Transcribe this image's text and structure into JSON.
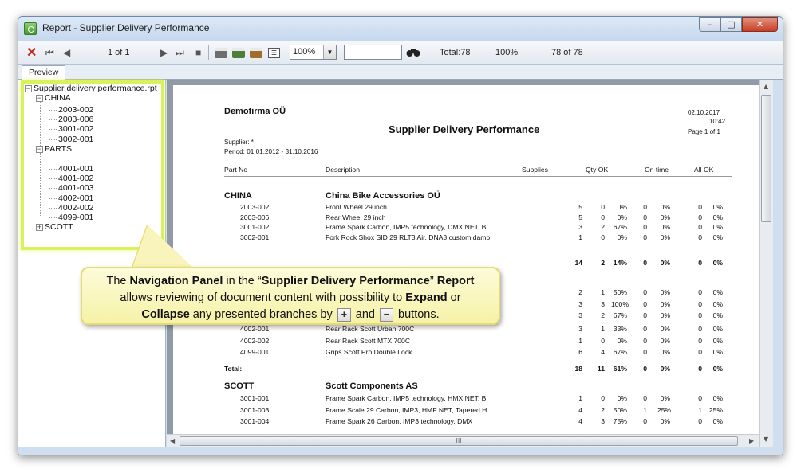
{
  "window": {
    "title": "Report - Supplier Delivery Performance",
    "buttons": {
      "minimize": "–",
      "maximize": "□",
      "close": "✕"
    }
  },
  "toolbar": {
    "close_icon": "✕",
    "first_icon": "⏮",
    "prev_icon": "◀",
    "page_indicator": "1 of 1",
    "next_icon": "▶",
    "last_icon": "⏭",
    "stop_icon": "■",
    "zoom": "100%",
    "search_value": "",
    "total": "Total:78",
    "percent": "100%",
    "record_count": "78 of 78"
  },
  "tabs": {
    "preview": "Preview"
  },
  "nav_tree": {
    "root": "Supplier delivery performance.rpt",
    "groups": [
      {
        "label": "CHINA",
        "items": [
          "2003-002",
          "2003-006",
          "3001-002",
          "3002-001"
        ]
      },
      {
        "label": "PARTS",
        "items": [
          "4001-001",
          "4001-002",
          "4001-003",
          "4002-001",
          "4002-002",
          "4099-001"
        ]
      },
      {
        "label": "SCOTT",
        "items": []
      }
    ]
  },
  "report": {
    "company": "Demofirma OÜ",
    "date": "02.10.2017",
    "time": "10:42",
    "title": "Supplier Delivery Performance",
    "page_info": "Page 1 of 1",
    "supplier": "Supplier: *",
    "period": "Period: 01.01.2012 - 31.10.2016",
    "columns": {
      "part_no": "Part No",
      "description": "Description",
      "supplies": "Supplies",
      "qty_ok": "Qty OK",
      "on_time": "On time",
      "all_ok": "All OK"
    },
    "china": {
      "code": "CHINA",
      "name": "China Bike Accessories OÜ",
      "rows": [
        [
          "2003-002",
          "Front Wheel 29 inch",
          "5",
          "0",
          "0%",
          "0",
          "0%",
          "0",
          "0%"
        ],
        [
          "2003-006",
          "Rear Wheel 29 inch",
          "5",
          "0",
          "0%",
          "0",
          "0%",
          "0",
          "0%"
        ],
        [
          "3001-002",
          "Frame Spark Carbon, IMP5 technology, DMX NET, B",
          "3",
          "2",
          "67%",
          "0",
          "0%",
          "0",
          "0%"
        ],
        [
          "3002-001",
          "Fork Rock Shox SID 29 RLT3 Air, DNA3 custom damp",
          "1",
          "0",
          "0%",
          "0",
          "0%",
          "0",
          "0%"
        ]
      ],
      "total": [
        "14",
        "2",
        "14%",
        "0",
        "0%",
        "0",
        "0%"
      ]
    },
    "parts": {
      "rows_partial": [
        [
          "2",
          "1",
          "50%",
          "0",
          "0%",
          "0",
          "0%"
        ],
        [
          "3",
          "3",
          "100%",
          "0",
          "0%",
          "0",
          "0%"
        ],
        [
          "3",
          "2",
          "67%",
          "0",
          "0%",
          "0",
          "0%"
        ]
      ],
      "rows": [
        [
          "4002-001",
          "Rear Rack Scott Urban 700C",
          "3",
          "1",
          "33%",
          "0",
          "0%",
          "0",
          "0%"
        ],
        [
          "4002-002",
          "Rear Rack Scott MTX 700C",
          "1",
          "0",
          "0%",
          "0",
          "0%",
          "0",
          "0%"
        ],
        [
          "4099-001",
          "Grips Scott Pro Double Lock",
          "6",
          "4",
          "67%",
          "0",
          "0%",
          "0",
          "0%"
        ]
      ],
      "total_label": "Total:",
      "total": [
        "18",
        "11",
        "61%",
        "0",
        "0%",
        "0",
        "0%"
      ]
    },
    "scott": {
      "code": "SCOTT",
      "name": "Scott Components AS",
      "rows": [
        [
          "3001-001",
          "Frame Spark Carbon, IMP5 technology, HMX NET, B",
          "1",
          "0",
          "0%",
          "0",
          "0%",
          "0",
          "0%"
        ],
        [
          "3001-003",
          "Frame Scale 29 Carbon, IMP3, HMF NET, Tapered H",
          "4",
          "2",
          "50%",
          "1",
          "25%",
          "1",
          "25%"
        ],
        [
          "3001-004",
          "Frame Spark 26 Carbon, IMP3 technology, DMX",
          "4",
          "3",
          "75%",
          "0",
          "0%",
          "0",
          "0%"
        ]
      ]
    }
  },
  "hscroll_label": "III",
  "callout": {
    "p1": "The ",
    "b1": "Navigation Panel",
    "p2": " in the “",
    "b2": "Supplier Delivery Performance",
    "p3": "” ",
    "b3": "Report",
    "p4": "allows reviewing of document content with possibility to ",
    "b4": "Expand",
    "p5": " or",
    "b5": "Collapse",
    "p6": " any presented branches by ",
    "btn_plus": "+",
    "p7": " and ",
    "btn_minus": "−",
    "p8": " buttons."
  }
}
